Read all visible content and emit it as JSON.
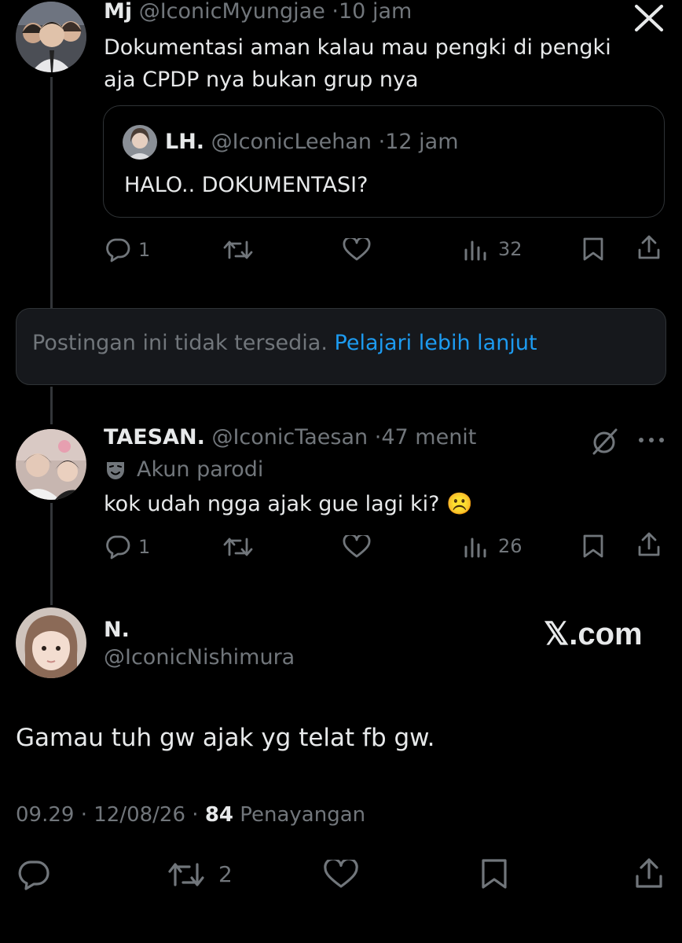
{
  "close_icon": "close-x-icon",
  "tweet1": {
    "name": "Mj",
    "handle": "@IconicMyungjae",
    "time": "10 jam",
    "text_line1": "Dokumentasi aman kalau mau pengki di pengki",
    "text_line2": "aja CPDP nya bukan grup nya",
    "quote": {
      "name": "LH.",
      "handle": "@IconicLeehan",
      "time": "12 jam",
      "text": "HALO.. DOKUMENTASI?"
    },
    "replies": "1",
    "views": "32"
  },
  "unavailable": {
    "text": "Postingan ini tidak tersedia.",
    "link": "Pelajari lebih lanjut",
    "link_color": "#1d9bf0"
  },
  "tweet2": {
    "name": "TAESAN.",
    "handle": "@IconicTaesan",
    "time": "47 menit",
    "parody_label": "Akun parodi",
    "text": "kok udah ngga ajak gue lagi ki? ☹️",
    "replies": "1",
    "views": "26"
  },
  "main": {
    "name": "N.",
    "handle": "@IconicNishimura",
    "watermark": "𝕏.com",
    "text": "Gamau tuh gw ajak yg telat fb gw.",
    "time": "09.29",
    "date": "12/08/26",
    "views_count": "84",
    "views_label": "Penayangan",
    "reposts": "2"
  },
  "colors": {
    "background": "#000000",
    "text": "#e7e9ea",
    "secondary": "#71767b",
    "accent": "#1d9bf0",
    "border": "#2f3336"
  }
}
